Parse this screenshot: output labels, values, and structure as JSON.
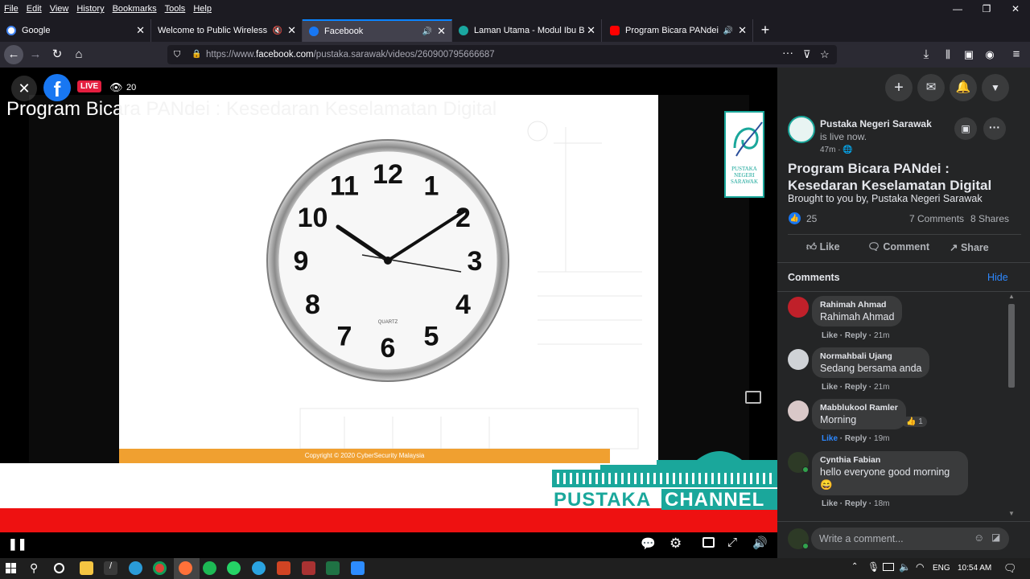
{
  "menubar": {
    "items": [
      "File",
      "Edit",
      "View",
      "History",
      "Bookmarks",
      "Tools",
      "Help"
    ]
  },
  "window_controls": {
    "minimize": "—",
    "restore": "❐",
    "close": "✕"
  },
  "tabs": [
    {
      "title": "Google",
      "favicon": "google-icon",
      "color": "#4285f4"
    },
    {
      "title": "Welcome to Public Wireless Net",
      "favicon": "none",
      "color": ""
    },
    {
      "title": "Facebook",
      "favicon": "facebook-icon",
      "color": "#1877f2"
    },
    {
      "title": "Laman Utama - Modul Ibu Bap",
      "favicon": "site-icon",
      "color": "#1aa7a0"
    },
    {
      "title": "Program Bicara PANdei : Ke",
      "favicon": "youtube-icon",
      "color": "#ff0000"
    }
  ],
  "new_tab_label": "+",
  "url": {
    "prefix": "https://www.",
    "domain": "facebook.com",
    "path": "/pustaka.sarawak/videos/260900795666687"
  },
  "video": {
    "live_badge": "LIVE",
    "viewer_count": "20",
    "stream_title": "Program Bicara PANdei : Kesedaran Keselamatan Digital",
    "clock_numbers": [
      "12",
      "1",
      "2",
      "3",
      "4",
      "5",
      "6",
      "7",
      "8",
      "9",
      "10",
      "11"
    ],
    "clock_brand": "QUARTZ",
    "copyright": "Copyright © 2020 CyberSecurity Malaysia",
    "channel_left": "PUSTAKA",
    "channel_right": "CHANNEL",
    "logo_lines": [
      "PUSTAKA",
      "NEGERI",
      "SARAWAK"
    ]
  },
  "post": {
    "page_name": "Pustaka Negeri Sarawak",
    "status_suffix": "is live now.",
    "time": "47m ·",
    "title": "Program Bicara PANdei : Kesedaran Keselamatan Digital",
    "subtitle": "Brought to you by, Pustaka Negeri Sarawak",
    "reactions": "25",
    "comments_count": "7 Comments",
    "shares_count": "8 Shares",
    "like_label": "Like",
    "comment_label": "Comment",
    "share_label": "Share"
  },
  "comments_header": {
    "label": "Comments",
    "hide": "Hide"
  },
  "comments": [
    {
      "name": "Rahimah Ahmad",
      "text": "Rahimah Ahmad",
      "meta_like": "Like",
      "meta_reply": "Reply",
      "time": "21m",
      "avatar_color": "#c0202a"
    },
    {
      "name": "Normahbali Ujang",
      "text": "Sedang bersama anda",
      "meta_like": "Like",
      "meta_reply": "Reply",
      "time": "21m",
      "avatar_color": "#cfd2d6"
    },
    {
      "name": "Mabblukool Ramler",
      "text": "Morning",
      "meta_like": "Like",
      "meta_reply": "Reply",
      "time": "19m",
      "avatar_color": "#d9c8c8",
      "reaction_count": "1"
    },
    {
      "name": "Cynthia Fabian",
      "text": "hello everyone good morning",
      "emoji": "😄",
      "meta_like": "Like",
      "meta_reply": "Reply",
      "time": "18m",
      "avatar_color": "#2d3a26"
    }
  ],
  "write_comment": {
    "placeholder": "Write a comment..."
  },
  "taskbar": {
    "lang": "ENG",
    "time": "10:54 AM"
  }
}
